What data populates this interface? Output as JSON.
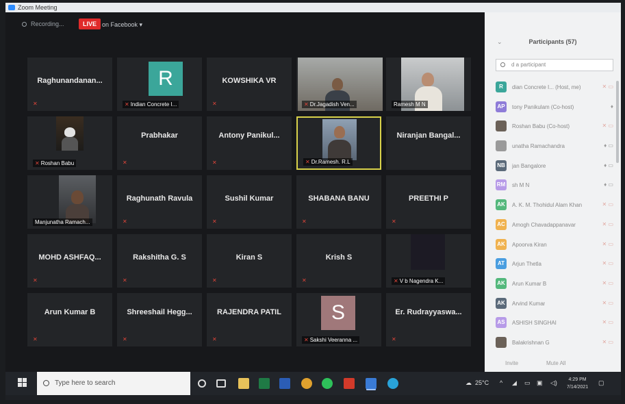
{
  "window": {
    "title": "Zoom Meeting"
  },
  "topbar": {
    "recording": "Recording...",
    "live": "LIVE",
    "live_dest": "on Facebook"
  },
  "tiles": [
    {
      "name": "Raghunandanan...",
      "kind": "name"
    },
    {
      "name": "Indian Concrete I...",
      "kind": "avatar",
      "letter": "R",
      "color": "#3ba69a"
    },
    {
      "name": "KOWSHIKA VR",
      "kind": "name"
    },
    {
      "name": "Dr.Jagadish Ven...",
      "kind": "video"
    },
    {
      "name": "Ramesh M N",
      "kind": "video"
    },
    {
      "name": "Roshan Babu",
      "kind": "video"
    },
    {
      "name": "Prabhakar",
      "kind": "name"
    },
    {
      "name": "Antony Panikul...",
      "kind": "name"
    },
    {
      "name": "Dr.Ramesh. R.L",
      "kind": "video"
    },
    {
      "name": "Niranjan Bangal...",
      "kind": "name"
    },
    {
      "name": "Manjunatha Ramach...",
      "kind": "video"
    },
    {
      "name": "Raghunath Ravula",
      "kind": "name"
    },
    {
      "name": "Sushil Kumar",
      "kind": "name"
    },
    {
      "name": "SHABANA BANU",
      "kind": "name"
    },
    {
      "name": "PREETHI P",
      "kind": "name"
    },
    {
      "name": "MOHD ASHFAQ...",
      "kind": "name"
    },
    {
      "name": "Rakshitha G. S",
      "kind": "name"
    },
    {
      "name": "Kiran S",
      "kind": "name"
    },
    {
      "name": "Krish S",
      "kind": "name"
    },
    {
      "name": "V b Nagendra K...",
      "kind": "video"
    },
    {
      "name": "Arun Kumar B",
      "kind": "name"
    },
    {
      "name": "Shreeshail Hegg...",
      "kind": "name"
    },
    {
      "name": "RAJENDRA PATIL",
      "kind": "name"
    },
    {
      "name": "Sakshi Veeranna ...",
      "kind": "avatar",
      "letter": "S",
      "color": "#a0787a"
    },
    {
      "name": "Er. Rudrayyaswa...",
      "kind": "name"
    }
  ],
  "panel": {
    "title": "Participants (57)",
    "search_placeholder": "d a participant",
    "participants": [
      {
        "initials": "R",
        "name": "dian Concrete I... (Host, me)",
        "color": "#3ba69a"
      },
      {
        "initials": "AP",
        "name": "tony Panikulam (Co-host)",
        "color": "#8e7cd8"
      },
      {
        "initials": "",
        "name": "Roshan Babu (Co-host)",
        "color": "#6b6158"
      },
      {
        "initials": "",
        "name": "unatha Ramachandra",
        "color": "#9a9a9a"
      },
      {
        "initials": "NB",
        "name": "jan Bangalore",
        "color": "#5b6a7a"
      },
      {
        "initials": "RM",
        "name": "sh M N",
        "color": "#b79be8"
      },
      {
        "initials": "AK",
        "name": "A. K. M. Thohidul Alam Khan",
        "color": "#54b87c"
      },
      {
        "initials": "AC",
        "name": "Amogh Chavadappanavar",
        "color": "#f0b24f"
      },
      {
        "initials": "AK",
        "name": "Apoorva Kiran",
        "color": "#f0b24f"
      },
      {
        "initials": "AT",
        "name": "Arjun Thetla",
        "color": "#4a9ee0"
      },
      {
        "initials": "AK",
        "name": "Arun Kumar B",
        "color": "#54b87c"
      },
      {
        "initials": "AK",
        "name": "Arvind Kumar",
        "color": "#5b6a7a"
      },
      {
        "initials": "AS",
        "name": "ASHISH SINGHAI",
        "color": "#b79be8"
      },
      {
        "initials": "",
        "name": "Balakrishnan G",
        "color": "#6b6158"
      }
    ],
    "invite": "Invite",
    "mute_all": "Mute All"
  },
  "taskbar": {
    "search_placeholder": "Type here to search",
    "temperature": "25°C",
    "time": "4:29 PM",
    "date": "7/14/2021"
  }
}
